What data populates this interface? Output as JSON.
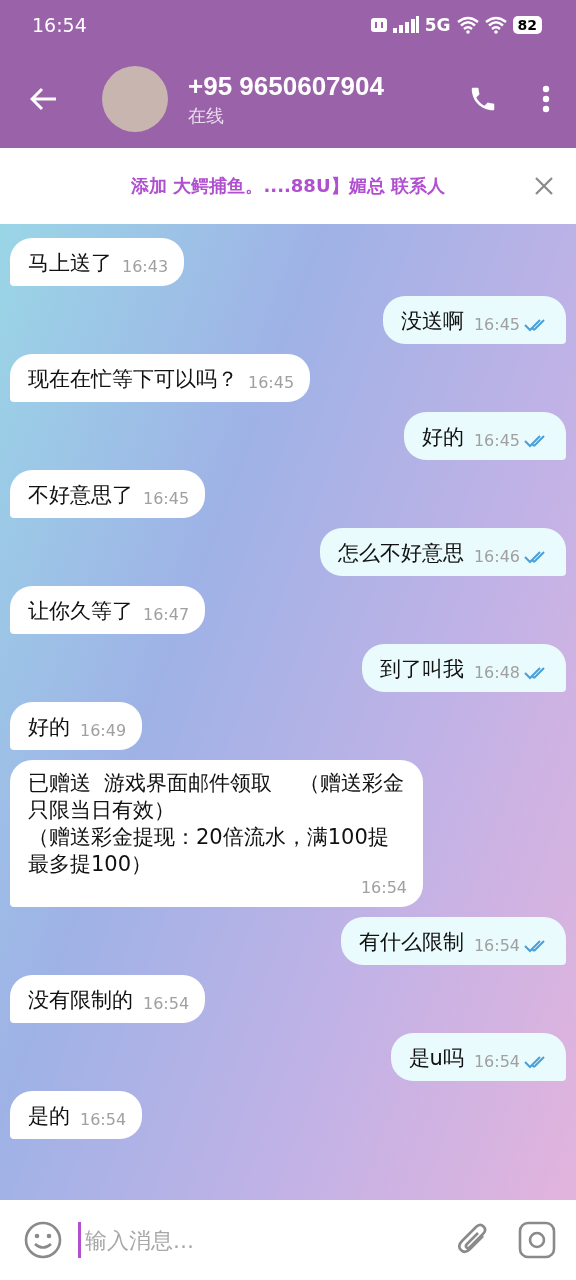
{
  "status_bar": {
    "time": "16:54",
    "network": "5G",
    "battery": "82"
  },
  "header": {
    "title": "+95 9650607904",
    "subtitle": "在线"
  },
  "banner": {
    "text": "添加 大鳄捕鱼。....88U】媚总 联系人"
  },
  "messages": [
    {
      "kind": "in",
      "text": "马上送了",
      "time": "16:43"
    },
    {
      "kind": "out",
      "text": "没送啊",
      "time": "16:45"
    },
    {
      "kind": "in",
      "text": "现在在忙等下可以吗？",
      "time": "16:45"
    },
    {
      "kind": "out",
      "text": "好的",
      "time": "16:45"
    },
    {
      "kind": "in",
      "text": "不好意思了",
      "time": "16:45"
    },
    {
      "kind": "out",
      "text": "怎么不好意思",
      "time": "16:46"
    },
    {
      "kind": "in",
      "text": "让你久等了",
      "time": "16:47"
    },
    {
      "kind": "out",
      "text": "到了叫我",
      "time": "16:48"
    },
    {
      "kind": "in",
      "text": "好的",
      "time": "16:49"
    },
    {
      "kind": "in",
      "paragraphs": [
        "已赠送  游戏界面邮件领取    （赠送彩金只限当日有效）",
        "（赠送彩金提现：20倍流水，满100提最多提100）"
      ],
      "time": "16:54"
    },
    {
      "kind": "out",
      "text": "有什么限制",
      "time": "16:54"
    },
    {
      "kind": "in",
      "text": "没有限制的",
      "time": "16:54"
    },
    {
      "kind": "out",
      "text": "是u吗",
      "time": "16:54"
    },
    {
      "kind": "in",
      "text": "是的",
      "time": "16:54"
    }
  ],
  "composer": {
    "placeholder": "输入消息..."
  }
}
